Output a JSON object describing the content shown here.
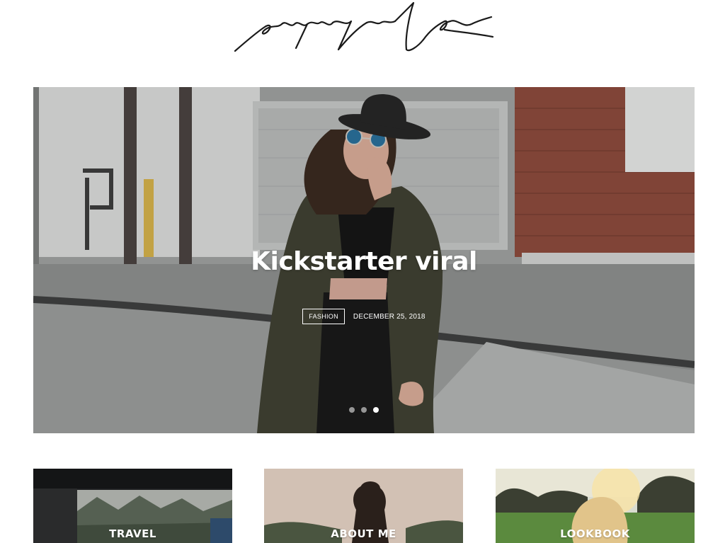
{
  "site": {
    "logo_text": "paperbag"
  },
  "hero": {
    "category": "FASHION",
    "date": "DECEMBER 25, 2018",
    "title": "Kickstarter viral",
    "slides_total": 3,
    "active_slide": 3
  },
  "categories": [
    {
      "label": "TRAVEL"
    },
    {
      "label": "ABOUT ME"
    },
    {
      "label": "LOOKBOOK"
    }
  ],
  "colors": {
    "text_on_image": "#ffffff",
    "background": "#ffffff",
    "logo_ink": "#1a1a1a"
  }
}
